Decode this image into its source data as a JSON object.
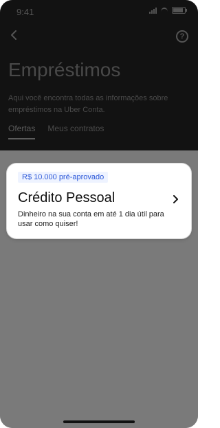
{
  "status_bar": {
    "time": "9:41"
  },
  "header": {
    "back_icon": "chevron-left-icon",
    "help_icon": "help-circle-icon",
    "title": "Empréstimos",
    "subtitle": "Aqui você encontra todas as informações sobre empréstimos na Uber Conta.",
    "tabs": [
      {
        "label": "Ofertas",
        "active": true
      },
      {
        "label": "Meus contratos",
        "active": false
      }
    ]
  },
  "offer_card": {
    "badge": "R$ 10.000 pré-aprovado",
    "title": "Crédito Pessoal",
    "description": "Dinheiro na sua conta em até 1 dia útil para usar como quiser!",
    "chevron_icon": "chevron-right-icon"
  },
  "colors": {
    "header_bg": "#121212",
    "overlay_bg": "#7a7a7a",
    "badge_bg": "#eef3ff",
    "badge_text": "#2b57d8"
  }
}
